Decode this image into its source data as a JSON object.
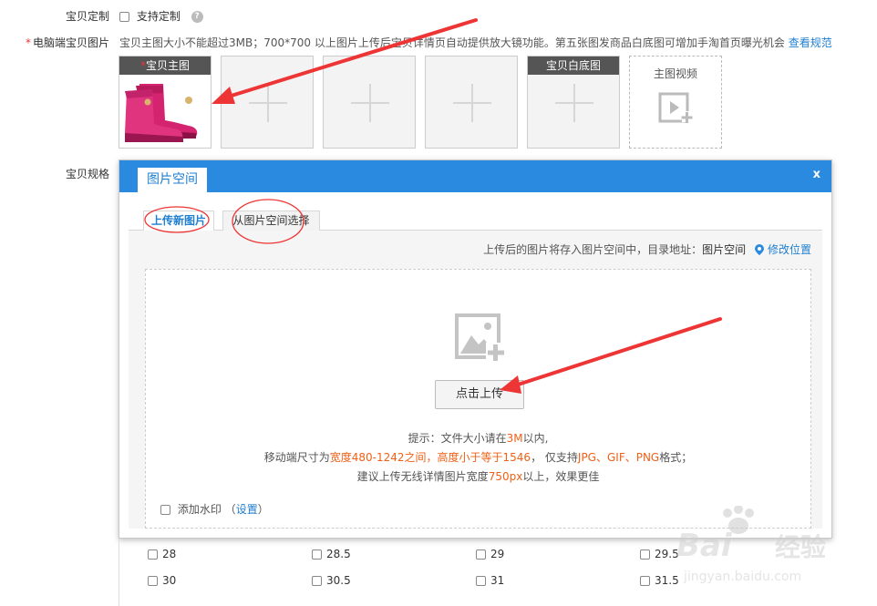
{
  "customize": {
    "label": "宝贝定制",
    "option": "支持定制",
    "help": "?"
  },
  "pc_images": {
    "required_mark": "*",
    "label": "电脑端宝贝图片",
    "hint": "宝贝主图大小不能超过3MB；700*700 以上图片上传后宝贝详情页自动提供放大镜功能。第五张图发商品白底图可增加手淘首页曝光机会",
    "hint_link": "查看规范",
    "slots": [
      {
        "caption": "宝贝主图",
        "mark": "*"
      },
      {
        "caption": ""
      },
      {
        "caption": ""
      },
      {
        "caption": ""
      },
      {
        "caption": "宝贝白底图"
      }
    ],
    "video_label": "主图视频"
  },
  "spec_label": "宝贝规格",
  "dialog": {
    "title": "图片空间",
    "close": "x",
    "tabs": [
      "上传新图片",
      "从图片空间选择"
    ],
    "info_prefix": "上传后的图片将存入图片空间中，目录地址：",
    "info_dir": "图片空间",
    "info_link": "修改位置",
    "upload_button": "点击上传",
    "tip1_a": "提示：文件大小请在",
    "tip1_b": "3M",
    "tip1_c": "以内,",
    "tip2_a": "移动端尺寸为",
    "tip2_b": "宽度480-1242之间，高度小于等于1546",
    "tip2_c": "， 仅支持",
    "tip2_d": "JPG、GIF、PNG",
    "tip2_e": "格式；",
    "tip3_a": "建议上传无线详情图片宽度",
    "tip3_b": "750px",
    "tip3_c": "以上，效果更佳",
    "watermark_label": "添加水印",
    "watermark_open": "（",
    "watermark_link": "设置",
    "watermark_close": "）"
  },
  "sizes": [
    [
      "28",
      "28.5",
      "29",
      "29.5"
    ],
    [
      "30",
      "30.5",
      "31",
      "31.5"
    ]
  ],
  "colors": {
    "accent": "#2a8ae0",
    "highlight": "#f06016",
    "arrow": "#ee3535"
  }
}
